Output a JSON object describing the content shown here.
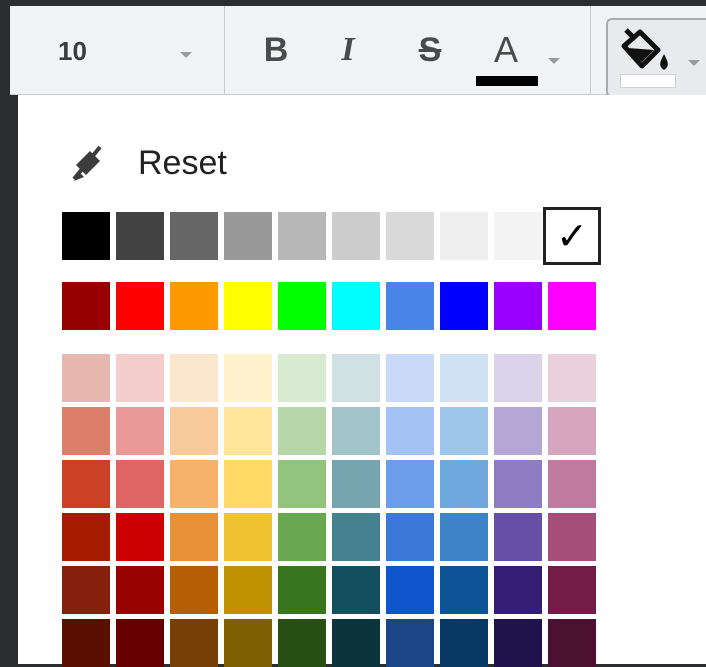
{
  "toolbar": {
    "font_size": "10",
    "bold_label": "B",
    "italic_label": "I",
    "strike_label": "S",
    "text_color_label": "A",
    "text_color_value": "#000000",
    "fill_color_value": "#ffffff"
  },
  "palette": {
    "reset_label": "Reset",
    "selected_check": "✓",
    "grays": [
      "#000000",
      "#434343",
      "#666666",
      "#999999",
      "#b7b7b7",
      "#cccccc",
      "#d9d9d9",
      "#efefef",
      "#f3f3f3",
      "#ffffff"
    ],
    "basic": [
      "#980000",
      "#ff0000",
      "#ff9900",
      "#ffff00",
      "#00ff00",
      "#00ffff",
      "#4a86e8",
      "#0000ff",
      "#9900ff",
      "#ff00ff"
    ],
    "shades": [
      [
        "#e6b8af",
        "#f4cccc",
        "#fce5cd",
        "#fff2cc",
        "#d9ead3",
        "#d0e0e3",
        "#c9daf8",
        "#cfe2f3",
        "#d9d2e9",
        "#ead1dc"
      ],
      [
        "#dd7e6b",
        "#ea9999",
        "#f9cb9c",
        "#ffe599",
        "#b6d7a8",
        "#a2c4c9",
        "#a4c2f4",
        "#9fc5e8",
        "#b4a7d6",
        "#d5a6bd"
      ],
      [
        "#cc4125",
        "#e06666",
        "#f6b26b",
        "#ffd966",
        "#93c47d",
        "#76a5af",
        "#6d9eeb",
        "#6fa8dc",
        "#8e7cc3",
        "#c27ba0"
      ],
      [
        "#a61c00",
        "#cc0000",
        "#e69138",
        "#f1c232",
        "#6aa84f",
        "#45818e",
        "#3c78d8",
        "#3d85c6",
        "#674ea7",
        "#a64d79"
      ],
      [
        "#85200c",
        "#990000",
        "#b45f06",
        "#bf9000",
        "#38761d",
        "#134f5c",
        "#1155cc",
        "#0b5394",
        "#351c75",
        "#741b47"
      ],
      [
        "#5b0f00",
        "#660000",
        "#783f04",
        "#7f6000",
        "#274e13",
        "#0c343d",
        "#1c4587",
        "#073763",
        "#20124d",
        "#4c1130"
      ]
    ]
  }
}
